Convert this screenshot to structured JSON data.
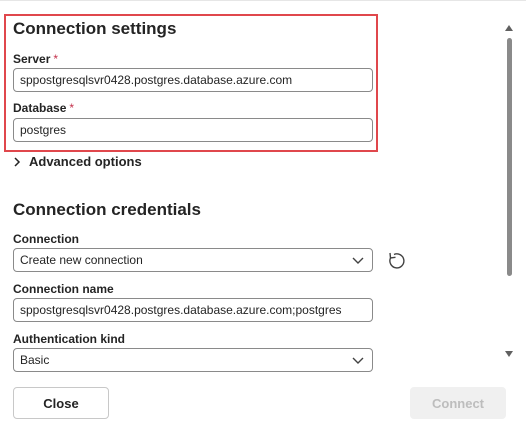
{
  "connection_settings": {
    "title": "Connection settings",
    "server": {
      "label": "Server",
      "required_mark": "*",
      "value": "sppostgresqlsvr0428.postgres.database.azure.com"
    },
    "database": {
      "label": "Database",
      "required_mark": "*",
      "value": "postgres"
    },
    "advanced_options": "Advanced options"
  },
  "connection_credentials": {
    "title": "Connection credentials",
    "connection": {
      "label": "Connection",
      "selected": "Create new connection"
    },
    "connection_name": {
      "label": "Connection name",
      "value": "sppostgresqlsvr0428.postgres.database.azure.com;postgres"
    },
    "authentication_kind": {
      "label": "Authentication kind",
      "selected": "Basic"
    }
  },
  "footer": {
    "close_label": "Close",
    "connect_label": "Connect"
  },
  "colors": {
    "highlight": "#e0474c",
    "required": "#c4314b",
    "disabled_text": "#bdbdbd"
  },
  "icons": {
    "advanced_toggle": "chevron-right-icon",
    "dropdown": "chevron-down-icon",
    "refresh": "refresh-icon"
  }
}
